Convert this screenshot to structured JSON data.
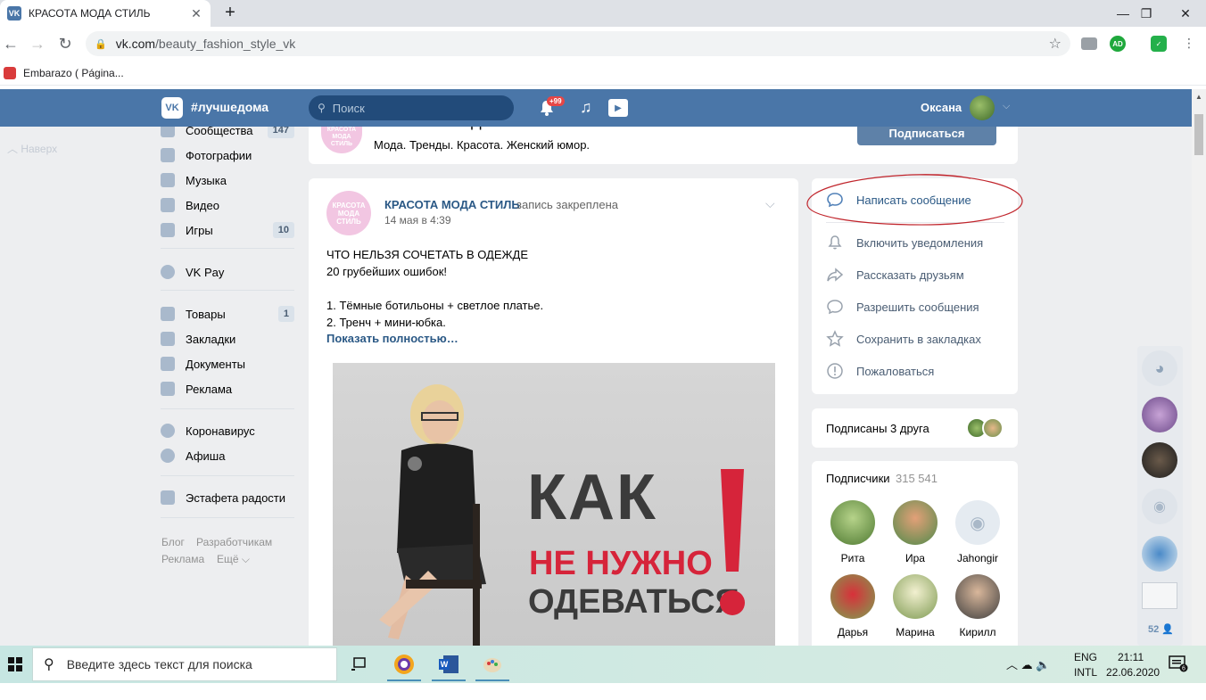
{
  "browser": {
    "tab_title": "КРАСОТА МОДА СТИЛЬ",
    "url_host": "vk.com",
    "url_path": "/beauty_fashion_style_vk",
    "bookmark": "Embarazo ( Página..."
  },
  "vk_header": {
    "logo": "VK",
    "hashtag": "#лучшедома",
    "search_placeholder": "Поиск",
    "notif_badge": "+99",
    "user_name": "Оксана"
  },
  "left_nav": {
    "back_to_top": "Наверх",
    "items": [
      {
        "label": "Сообщества",
        "count": "147"
      },
      {
        "label": "Фотографии",
        "count": ""
      },
      {
        "label": "Музыка",
        "count": ""
      },
      {
        "label": "Видео",
        "count": ""
      },
      {
        "label": "Игры",
        "count": "10"
      },
      {
        "label": "VK Pay",
        "count": ""
      },
      {
        "label": "Товары",
        "count": "1"
      },
      {
        "label": "Закладки",
        "count": ""
      },
      {
        "label": "Документы",
        "count": ""
      },
      {
        "label": "Реклама",
        "count": ""
      },
      {
        "label": "Коронавирус",
        "count": ""
      },
      {
        "label": "Афиша",
        "count": ""
      },
      {
        "label": "Эстафета радости",
        "count": ""
      }
    ],
    "footer": {
      "blog": "Блог",
      "dev": "Разработчикам",
      "ads": "Реклама",
      "more": "Ещё"
    }
  },
  "community": {
    "logo_text": "КРАСОТА МОДА СТИЛЬ",
    "name": "КРАСОТА МОДА СТИЛЬ",
    "status": "Мода. Тренды. Красота. Женский юмор.",
    "subscribe_label": "Подписаться"
  },
  "post": {
    "author": "КРАСОТА МОДА СТИЛЬ",
    "pinned": "запись закреплена",
    "date": "14 мая в 4:39",
    "lines": [
      "ЧТО НЕЛЬЗЯ СОЧЕТАТЬ В ОДЕЖДЕ",
      "20 грубейших ошибок!",
      "1. Тёмные ботильоны + светлое платье.",
      "2. Тренч + мини-юбка."
    ],
    "show_more": "Показать полностью…",
    "image_text": {
      "line1": "КАК",
      "line2": "НЕ НУЖНО",
      "line3": "ОДЕВАТЬСЯ"
    }
  },
  "actions": [
    {
      "label": "Написать сообщение",
      "icon": "message-icon"
    },
    {
      "label": "Включить уведомления",
      "icon": "bell-icon"
    },
    {
      "label": "Рассказать друзьям",
      "icon": "share-icon"
    },
    {
      "label": "Разрешить сообщения",
      "icon": "chat-icon"
    },
    {
      "label": "Сохранить в закладках",
      "icon": "star-icon"
    },
    {
      "label": "Пожаловаться",
      "icon": "report-icon"
    }
  ],
  "friends": {
    "label": "Подписаны 3 друга"
  },
  "subscribers": {
    "title": "Подписчики",
    "count": "315 541",
    "people": [
      "Рита",
      "Ира",
      "Jahongir",
      "Дарья",
      "Марина",
      "Кирилл"
    ]
  },
  "chat_bar": {
    "count": "52"
  },
  "taskbar": {
    "search_placeholder": "Введите здесь текст для поиска",
    "lang1": "ENG",
    "lang2": "INTL",
    "time": "21:11",
    "date": "22.06.2020",
    "notif_count": "6"
  },
  "colors": {
    "vk_blue": "#4a76a8",
    "link": "#2a5885",
    "accent_red": "#d6243a",
    "page_bg": "#edeef0"
  }
}
